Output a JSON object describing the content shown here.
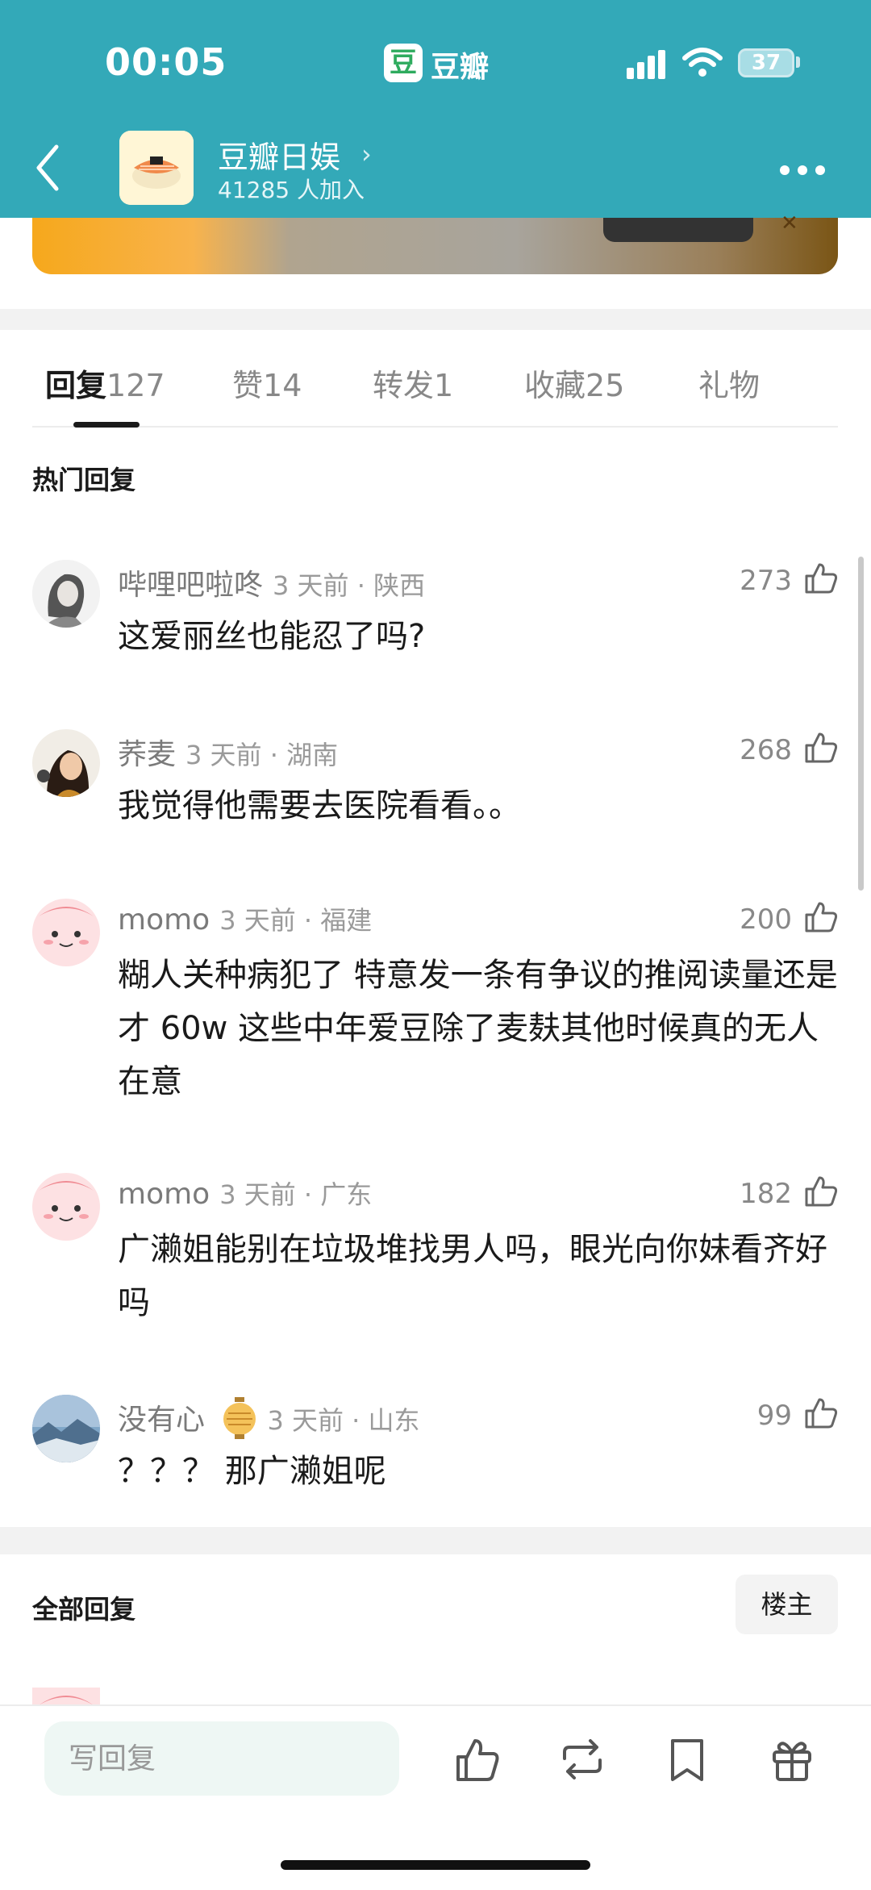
{
  "status_bar": {
    "time": "00:05",
    "app_logo": "豆",
    "app_name": "豆瓣",
    "battery": "37"
  },
  "header": {
    "group_name": "豆瓣日娱",
    "group_members": "41285 人加入"
  },
  "tabs": [
    {
      "label": "回复",
      "count": "127",
      "active": true
    },
    {
      "label": "赞",
      "count": "14"
    },
    {
      "label": "转发",
      "count": "1"
    },
    {
      "label": "收藏",
      "count": "25"
    },
    {
      "label": "礼物",
      "count": ""
    }
  ],
  "hot_replies": {
    "title": "热门回复",
    "comments": [
      {
        "user": "哔哩吧啦咚",
        "meta": "3 天前 · 陕西",
        "likes": "273",
        "text": "这爱丽丝也能忍了吗?"
      },
      {
        "user": "荞麦",
        "meta": "3 天前 · 湖南",
        "likes": "268",
        "text": "我觉得他需要去医院看看。。"
      },
      {
        "user": "momo",
        "meta": "3 天前 · 福建",
        "likes": "200",
        "text": "糊人关种病犯了 特意发一条有争议的推阅读量还是才 60w 这些中年爱豆除了麦麸其他时候真的无人在意"
      },
      {
        "user": "momo",
        "meta": "3 天前 · 广东",
        "likes": "182",
        "text": "广濑姐能别在垃圾堆找男人吗，眼光向你妹看齐好吗"
      },
      {
        "user": "没有心",
        "meta": "3 天前 · 山东",
        "likes": "99",
        "text": "？？？ 那广濑姐呢"
      }
    ]
  },
  "all_replies": {
    "title": "全部回复",
    "op_button": "楼主"
  },
  "bottom_bar": {
    "reply_placeholder": "写回复"
  },
  "icons": [
    "back-icon",
    "more-icon",
    "thumb-up-icon",
    "repost-icon",
    "bookmark-icon",
    "gift-icon",
    "lantern-icon",
    "signal-icon",
    "wifi-icon"
  ],
  "colors": {
    "header": "#33a9b8",
    "input_bg": "#eef7f4",
    "band": "#f2f2f2"
  }
}
